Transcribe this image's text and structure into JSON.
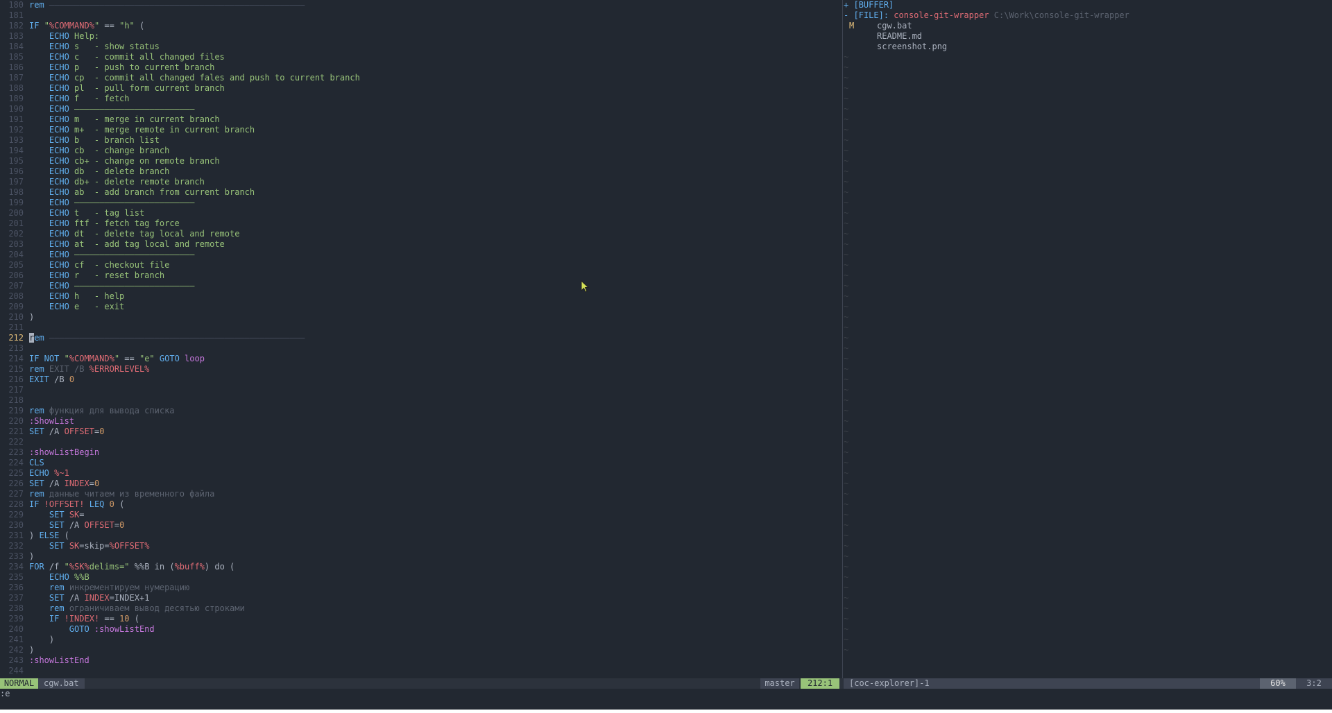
{
  "editor": {
    "lines": [
      {
        "n": "180",
        "t": [
          [
            "kw",
            "rem "
          ],
          [
            "sep",
            "———————————————————————————————————————————————————"
          ]
        ]
      },
      {
        "n": "181",
        "t": []
      },
      {
        "n": "182",
        "t": [
          [
            "kw",
            "IF "
          ],
          [
            "str",
            "\""
          ],
          [
            "var",
            "%COMMAND%"
          ],
          [
            "str",
            "\""
          ],
          [
            "op",
            " == "
          ],
          [
            "str",
            "\"h\""
          ],
          [
            "op",
            " ("
          ]
        ]
      },
      {
        "n": "183",
        "t": [
          [
            "op",
            "    "
          ],
          [
            "kw",
            "ECHO "
          ],
          [
            "str",
            "Help:"
          ]
        ]
      },
      {
        "n": "184",
        "t": [
          [
            "op",
            "    "
          ],
          [
            "kw",
            "ECHO "
          ],
          [
            "str",
            "s   - show status"
          ]
        ]
      },
      {
        "n": "185",
        "t": [
          [
            "op",
            "    "
          ],
          [
            "kw",
            "ECHO "
          ],
          [
            "str",
            "c   - commit all changed files"
          ]
        ]
      },
      {
        "n": "186",
        "t": [
          [
            "op",
            "    "
          ],
          [
            "kw",
            "ECHO "
          ],
          [
            "str",
            "p   - push to current branch"
          ]
        ]
      },
      {
        "n": "187",
        "t": [
          [
            "op",
            "    "
          ],
          [
            "kw",
            "ECHO "
          ],
          [
            "str",
            "cp  - commit all changed fales and push to current branch"
          ]
        ]
      },
      {
        "n": "188",
        "t": [
          [
            "op",
            "    "
          ],
          [
            "kw",
            "ECHO "
          ],
          [
            "str",
            "pl  - pull form current branch"
          ]
        ]
      },
      {
        "n": "189",
        "t": [
          [
            "op",
            "    "
          ],
          [
            "kw",
            "ECHO "
          ],
          [
            "str",
            "f   - fetch"
          ]
        ]
      },
      {
        "n": "190",
        "t": [
          [
            "op",
            "    "
          ],
          [
            "kw",
            "ECHO "
          ],
          [
            "str",
            "————————————————————————"
          ]
        ]
      },
      {
        "n": "191",
        "t": [
          [
            "op",
            "    "
          ],
          [
            "kw",
            "ECHO "
          ],
          [
            "str",
            "m   - merge in current branch"
          ]
        ]
      },
      {
        "n": "192",
        "t": [
          [
            "op",
            "    "
          ],
          [
            "kw",
            "ECHO "
          ],
          [
            "str",
            "m+  - merge remote in current branch"
          ]
        ]
      },
      {
        "n": "193",
        "t": [
          [
            "op",
            "    "
          ],
          [
            "kw",
            "ECHO "
          ],
          [
            "str",
            "b   - branch list"
          ]
        ]
      },
      {
        "n": "194",
        "t": [
          [
            "op",
            "    "
          ],
          [
            "kw",
            "ECHO "
          ],
          [
            "str",
            "cb  - change branch"
          ]
        ]
      },
      {
        "n": "195",
        "t": [
          [
            "op",
            "    "
          ],
          [
            "kw",
            "ECHO "
          ],
          [
            "str",
            "cb+ - change on remote branch"
          ]
        ]
      },
      {
        "n": "196",
        "t": [
          [
            "op",
            "    "
          ],
          [
            "kw",
            "ECHO "
          ],
          [
            "str",
            "db  - delete branch"
          ]
        ]
      },
      {
        "n": "197",
        "t": [
          [
            "op",
            "    "
          ],
          [
            "kw",
            "ECHO "
          ],
          [
            "str",
            "db+ - delete remote branch"
          ]
        ]
      },
      {
        "n": "198",
        "t": [
          [
            "op",
            "    "
          ],
          [
            "kw",
            "ECHO "
          ],
          [
            "str",
            "ab  - add branch from current branch"
          ]
        ]
      },
      {
        "n": "199",
        "t": [
          [
            "op",
            "    "
          ],
          [
            "kw",
            "ECHO "
          ],
          [
            "str",
            "————————————————————————"
          ]
        ]
      },
      {
        "n": "200",
        "t": [
          [
            "op",
            "    "
          ],
          [
            "kw",
            "ECHO "
          ],
          [
            "str",
            "t   - tag list"
          ]
        ]
      },
      {
        "n": "201",
        "t": [
          [
            "op",
            "    "
          ],
          [
            "kw",
            "ECHO "
          ],
          [
            "str",
            "ftf - fetch tag force"
          ]
        ]
      },
      {
        "n": "202",
        "t": [
          [
            "op",
            "    "
          ],
          [
            "kw",
            "ECHO "
          ],
          [
            "str",
            "dt  - delete tag local and remote"
          ]
        ]
      },
      {
        "n": "203",
        "t": [
          [
            "op",
            "    "
          ],
          [
            "kw",
            "ECHO "
          ],
          [
            "str",
            "at  - add tag local and remote"
          ]
        ]
      },
      {
        "n": "204",
        "t": [
          [
            "op",
            "    "
          ],
          [
            "kw",
            "ECHO "
          ],
          [
            "str",
            "————————————————————————"
          ]
        ]
      },
      {
        "n": "205",
        "t": [
          [
            "op",
            "    "
          ],
          [
            "kw",
            "ECHO "
          ],
          [
            "str",
            "cf  - checkout file"
          ]
        ]
      },
      {
        "n": "206",
        "t": [
          [
            "op",
            "    "
          ],
          [
            "kw",
            "ECHO "
          ],
          [
            "str",
            "r   - reset branch"
          ]
        ]
      },
      {
        "n": "207",
        "t": [
          [
            "op",
            "    "
          ],
          [
            "kw",
            "ECHO "
          ],
          [
            "str",
            "————————————————————————"
          ]
        ]
      },
      {
        "n": "208",
        "t": [
          [
            "op",
            "    "
          ],
          [
            "kw",
            "ECHO "
          ],
          [
            "str",
            "h   - help"
          ]
        ]
      },
      {
        "n": "209",
        "t": [
          [
            "op",
            "    "
          ],
          [
            "kw",
            "ECHO "
          ],
          [
            "str",
            "e   - exit"
          ]
        ]
      },
      {
        "n": "210",
        "t": [
          [
            "op",
            ")"
          ]
        ]
      },
      {
        "n": "211",
        "t": []
      },
      {
        "n": "212",
        "cur": true,
        "t": [
          [
            "cursor",
            "r"
          ],
          [
            "kw",
            "em "
          ],
          [
            "sep",
            "———————————————————————————————————————————————————"
          ]
        ]
      },
      {
        "n": "213",
        "t": []
      },
      {
        "n": "214",
        "t": [
          [
            "kw",
            "IF NOT "
          ],
          [
            "str",
            "\""
          ],
          [
            "var",
            "%COMMAND%"
          ],
          [
            "str",
            "\""
          ],
          [
            "op",
            " == "
          ],
          [
            "str",
            "\"e\""
          ],
          [
            "op",
            " "
          ],
          [
            "kw",
            "GOTO "
          ],
          [
            "lbl",
            "loop"
          ]
        ]
      },
      {
        "n": "215",
        "t": [
          [
            "kw",
            "rem "
          ],
          [
            "cmt",
            "EXIT /B "
          ],
          [
            "var",
            "%ERRORLEVEL%"
          ]
        ]
      },
      {
        "n": "216",
        "t": [
          [
            "kw",
            "EXIT "
          ],
          [
            "op",
            "/B "
          ],
          [
            "num-lit",
            "0"
          ]
        ]
      },
      {
        "n": "217",
        "t": []
      },
      {
        "n": "218",
        "t": []
      },
      {
        "n": "219",
        "t": [
          [
            "kw",
            "rem "
          ],
          [
            "cmt",
            "функция для вывода списка"
          ]
        ]
      },
      {
        "n": "220",
        "t": [
          [
            "lbl",
            ":ShowList"
          ]
        ]
      },
      {
        "n": "221",
        "t": [
          [
            "kw",
            "SET "
          ],
          [
            "op",
            "/A "
          ],
          [
            "var",
            "OFFSET"
          ],
          [
            "op",
            "="
          ],
          [
            "num-lit",
            "0"
          ]
        ]
      },
      {
        "n": "222",
        "t": []
      },
      {
        "n": "223",
        "t": [
          [
            "lbl",
            ":showListBegin"
          ]
        ]
      },
      {
        "n": "224",
        "t": [
          [
            "kw",
            "CLS"
          ]
        ]
      },
      {
        "n": "225",
        "t": [
          [
            "kw",
            "ECHO "
          ],
          [
            "var",
            "%~1"
          ]
        ]
      },
      {
        "n": "226",
        "t": [
          [
            "kw",
            "SET "
          ],
          [
            "op",
            "/A "
          ],
          [
            "var",
            "INDEX"
          ],
          [
            "op",
            "="
          ],
          [
            "num-lit",
            "0"
          ]
        ]
      },
      {
        "n": "227",
        "t": [
          [
            "kw",
            "rem "
          ],
          [
            "cmt",
            "данные читаем из временного файла"
          ]
        ]
      },
      {
        "n": "228",
        "t": [
          [
            "kw",
            "IF "
          ],
          [
            "var",
            "!OFFSET!"
          ],
          [
            "op",
            " "
          ],
          [
            "kw",
            "LEQ "
          ],
          [
            "num-lit",
            "0"
          ],
          [
            "op",
            " ("
          ]
        ]
      },
      {
        "n": "229",
        "t": [
          [
            "op",
            "    "
          ],
          [
            "kw",
            "SET "
          ],
          [
            "var",
            "SK"
          ],
          [
            "op",
            "="
          ]
        ]
      },
      {
        "n": "230",
        "t": [
          [
            "op",
            "    "
          ],
          [
            "kw",
            "SET "
          ],
          [
            "op",
            "/A "
          ],
          [
            "var",
            "OFFSET"
          ],
          [
            "op",
            "="
          ],
          [
            "num-lit",
            "0"
          ]
        ]
      },
      {
        "n": "231",
        "t": [
          [
            "op",
            ") "
          ],
          [
            "kw",
            "ELSE"
          ],
          [
            "op",
            " ("
          ]
        ]
      },
      {
        "n": "232",
        "t": [
          [
            "op",
            "    "
          ],
          [
            "kw",
            "SET "
          ],
          [
            "var",
            "SK"
          ],
          [
            "op",
            "=skip="
          ],
          [
            "var",
            "%OFFSET%"
          ]
        ]
      },
      {
        "n": "233",
        "t": [
          [
            "op",
            ")"
          ]
        ]
      },
      {
        "n": "234",
        "t": [
          [
            "kw",
            "FOR "
          ],
          [
            "op",
            "/f "
          ],
          [
            "str",
            "\""
          ],
          [
            "var",
            "%SK%"
          ],
          [
            "str",
            "delims=\""
          ],
          [
            "op",
            " %%B in ("
          ],
          [
            "var",
            "%buff%"
          ],
          [
            "op",
            ") do ("
          ]
        ]
      },
      {
        "n": "235",
        "t": [
          [
            "op",
            "    "
          ],
          [
            "kw",
            "ECHO "
          ],
          [
            "str",
            "%%B"
          ]
        ]
      },
      {
        "n": "236",
        "t": [
          [
            "op",
            "    "
          ],
          [
            "kw",
            "rem "
          ],
          [
            "cmt",
            "инкрементируем нумерацию"
          ]
        ]
      },
      {
        "n": "237",
        "t": [
          [
            "op",
            "    "
          ],
          [
            "kw",
            "SET "
          ],
          [
            "op",
            "/A "
          ],
          [
            "var",
            "INDEX"
          ],
          [
            "op",
            "=INDEX+1"
          ]
        ]
      },
      {
        "n": "238",
        "t": [
          [
            "op",
            "    "
          ],
          [
            "kw",
            "rem "
          ],
          [
            "cmt",
            "ограничиваем вывод десятью строками"
          ]
        ]
      },
      {
        "n": "239",
        "t": [
          [
            "op",
            "    "
          ],
          [
            "kw",
            "IF "
          ],
          [
            "var",
            "!INDEX!"
          ],
          [
            "op",
            " == "
          ],
          [
            "num-lit",
            "10"
          ],
          [
            "op",
            " ("
          ]
        ]
      },
      {
        "n": "240",
        "t": [
          [
            "op",
            "        "
          ],
          [
            "kw",
            "GOTO "
          ],
          [
            "lbl",
            ":showListEnd"
          ]
        ]
      },
      {
        "n": "241",
        "t": [
          [
            "op",
            "    )"
          ]
        ]
      },
      {
        "n": "242",
        "t": [
          [
            "op",
            ")"
          ]
        ]
      },
      {
        "n": "243",
        "t": [
          [
            "lbl",
            ":showListEnd"
          ]
        ]
      },
      {
        "n": "244",
        "t": []
      }
    ]
  },
  "explorer": {
    "buffer_row": {
      "sign": "+",
      "label": "[BUFFER]"
    },
    "file_row": {
      "sign": "-",
      "label": "[FILE]:",
      "root": "console-git-wrapper",
      "path": "C:\\Work\\console-git-wrapper"
    },
    "files": [
      {
        "git": "M",
        "name": "cgw.bat"
      },
      {
        "git": "",
        "name": "README.md"
      },
      {
        "git": "",
        "name": "screenshot.png"
      }
    ],
    "tilde_rows": 58
  },
  "status": {
    "mode": "NORMAL",
    "file": "cgw.bat",
    "branch": "master",
    "position": "212:1",
    "explorer_name": "[coc-explorer]-1",
    "percent": "60%",
    "explorer_position": "3:2"
  },
  "cmdline": {
    "text": ":e"
  },
  "colors": {
    "bg": "#222831",
    "keyword": "#61afef",
    "string": "#98c379",
    "variable": "#e06c75",
    "label": "#c678dd",
    "number": "#d19a66",
    "comment": "#5c6370",
    "mode_bg": "#98c379"
  }
}
